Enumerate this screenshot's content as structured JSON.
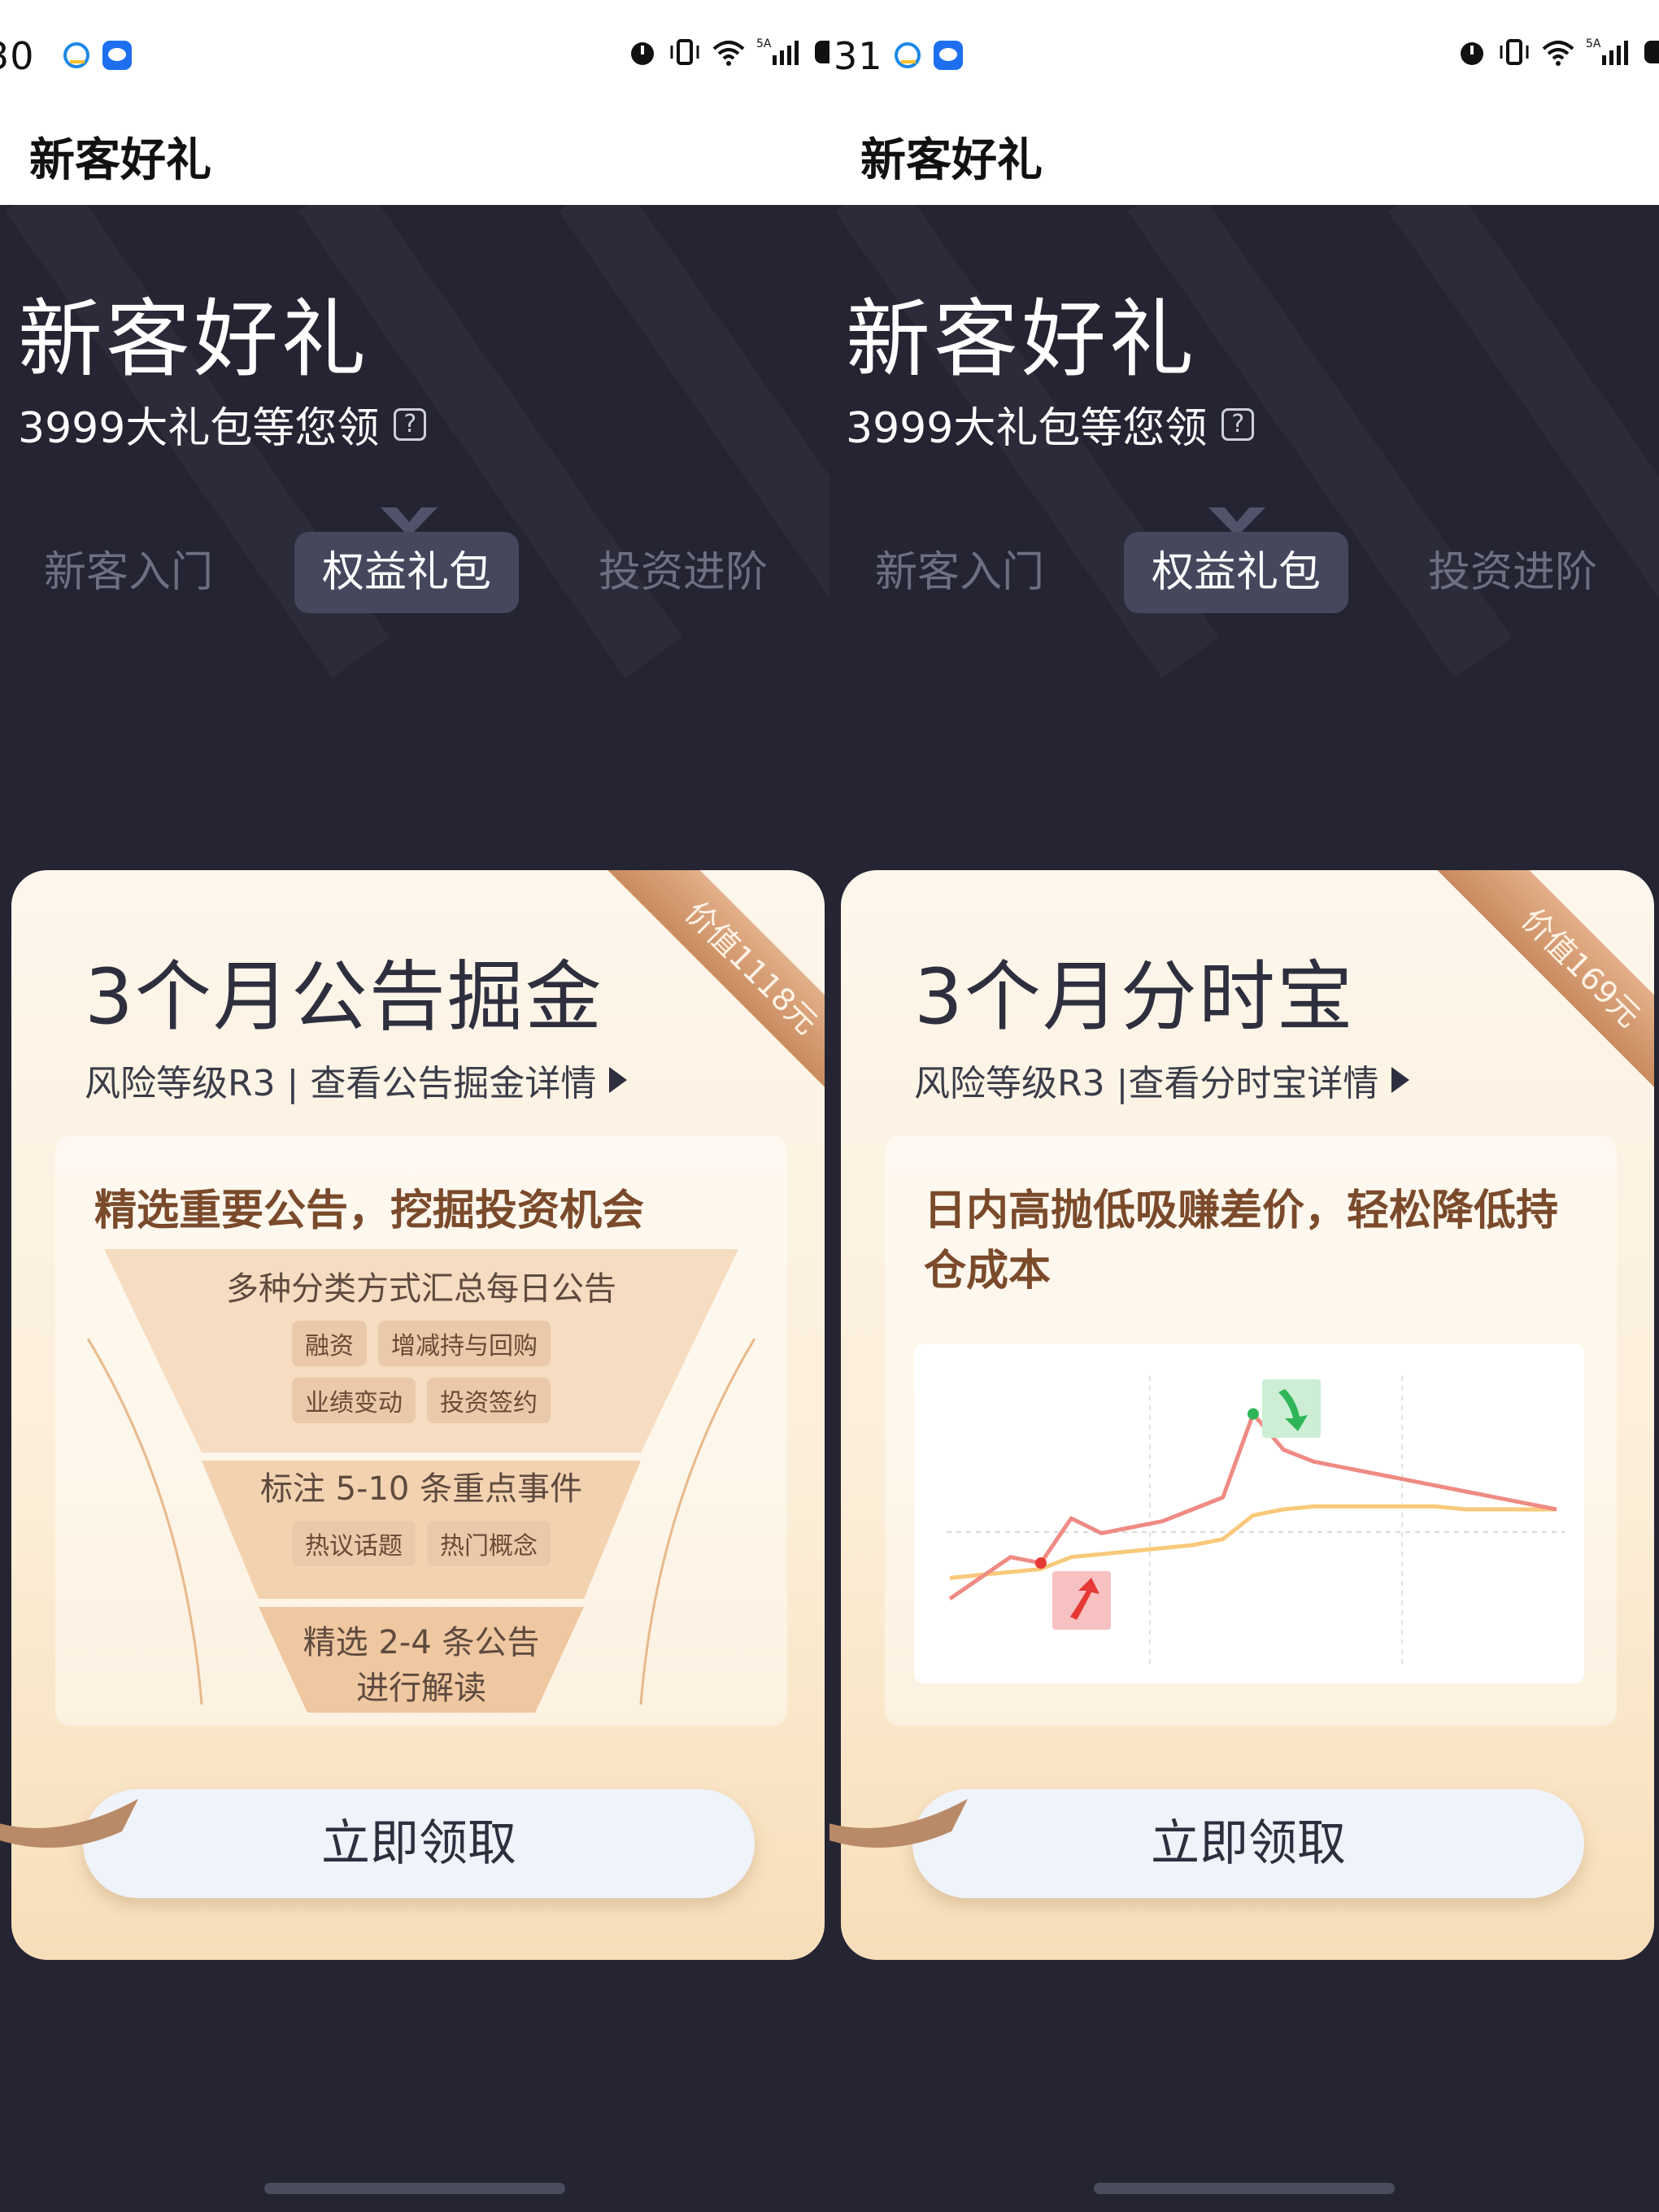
{
  "screens": [
    {
      "status": {
        "time": "30"
      },
      "nav_title": "新客好礼",
      "hero": {
        "title": "新客好礼",
        "subtitle": "3999大礼包等您领",
        "help_symbol": "?"
      },
      "tabs": [
        {
          "label": "新客入门",
          "active": false
        },
        {
          "label": "权益礼包",
          "active": true
        },
        {
          "label": "投资进阶",
          "active": false
        }
      ],
      "card": {
        "ribbon": "价值1118元",
        "title": "3个月公告掘金",
        "meta": "风险等级R3 | 查看公告掘金详情",
        "headline": "精选重要公告，挖掘投资机会",
        "funnel": [
          {
            "text": "多种分类方式汇总每日公告",
            "chips": [
              "融资",
              "增减持与回购",
              "业绩变动",
              "投资签约"
            ]
          },
          {
            "text": "标注 5-10 条重点事件",
            "chips": [
              "热议话题",
              "热门概念"
            ]
          },
          {
            "text": "精选 2-4 条公告",
            "text2": "进行解读",
            "chips": []
          }
        ],
        "cta": "立即领取"
      }
    },
    {
      "status": {
        "time": "31"
      },
      "nav_title": "新客好礼",
      "hero": {
        "title": "新客好礼",
        "subtitle": "3999大礼包等您领",
        "help_symbol": "?"
      },
      "tabs": [
        {
          "label": "新客入门",
          "active": false
        },
        {
          "label": "权益礼包",
          "active": true
        },
        {
          "label": "投资进阶",
          "active": false
        }
      ],
      "card": {
        "ribbon": "价值169元",
        "title": "3个月分时宝",
        "meta": "风险等级R3 |查看分时宝详情",
        "headline": "日内高抛低吸赚差价，轻松降低持仓成本",
        "cta": "立即领取"
      }
    }
  ],
  "chart_data": {
    "type": "line",
    "x": [
      0,
      1,
      2,
      3,
      4,
      5,
      6,
      7,
      8,
      9,
      10,
      11,
      12,
      13,
      14,
      15,
      16,
      17,
      18,
      19,
      20
    ],
    "series": [
      {
        "values": [
          38,
          45,
          52,
          50,
          65,
          60,
          62,
          64,
          68,
          72,
          100,
          88,
          84,
          82,
          80,
          78,
          76,
          74,
          72,
          70,
          68
        ]
      },
      {
        "values": [
          45,
          46,
          47,
          48,
          52,
          53,
          54,
          55,
          56,
          58,
          66,
          68,
          69,
          69,
          69,
          69,
          69,
          68,
          68,
          68,
          68
        ]
      }
    ],
    "ylim": [
      20,
      110
    ],
    "colors": {
      "price": "#ef8b84",
      "avg": "#f8c97a",
      "buy": "#e53935",
      "sell": "#2fb557"
    }
  }
}
